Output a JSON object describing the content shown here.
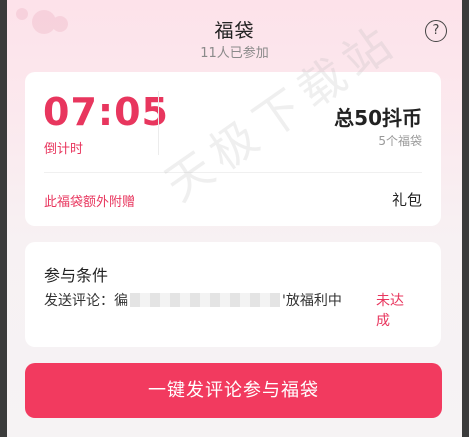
{
  "header": {
    "title": "福袋",
    "subtitle": "11人已参加",
    "help_icon": "question-circle-icon",
    "help_glyph": "?"
  },
  "reward": {
    "countdown": "07:05",
    "countdown_label": "倒计时",
    "total": "总50抖币",
    "bag_count": "5个福袋",
    "extra_link": "此福袋额外附赠",
    "extra_gift": "礼包"
  },
  "condition": {
    "title": "参与条件",
    "text_prefix": "发送评论：徧",
    "text_suffix": "'放福利中",
    "status": "未达成"
  },
  "action": {
    "join_label": "一键发评论参与福袋"
  },
  "watermark": {
    "text": "天极下载站"
  },
  "colors": {
    "accent": "#e8365e",
    "button": "#f23a5f"
  }
}
